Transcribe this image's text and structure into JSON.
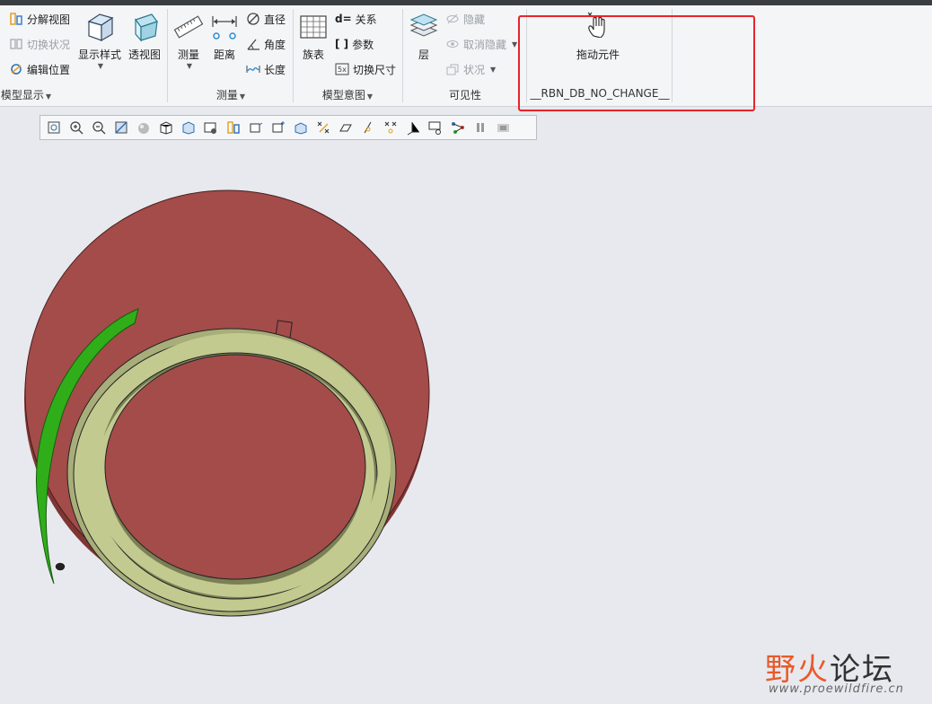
{
  "ribbon": {
    "model_display": {
      "exploded_view": "分解视图",
      "toggle_status": "切换状况",
      "edit_position": "编辑位置",
      "display_style": "显示样式",
      "perspective": "透视图",
      "group_label": "模型显示"
    },
    "measure": {
      "measure": "测量",
      "distance": "距离",
      "diameter": "直径",
      "angle": "角度",
      "length": "长度",
      "group_label": "测量"
    },
    "model_intent": {
      "family_table": "族表",
      "relations_prefix": "d=",
      "relations": "关系",
      "parameters_prefix": "[ ]",
      "parameters": "参数",
      "switch_dims": "切换尺寸",
      "group_label": "模型意图"
    },
    "visibility": {
      "layers": "层",
      "hide": "隐藏",
      "unhide": "取消隐藏",
      "status": "状况",
      "group_label": "可见性"
    },
    "custom": {
      "drag_components": "拖动元件",
      "group_label": "__RBN_DB_NO_CHANGE__"
    }
  },
  "view_toolbar": {
    "buttons": [
      "refit-icon",
      "zoom-in-icon",
      "zoom-out-icon",
      "repaint-icon",
      "display-style-icon",
      "saved-orientations-icon",
      "named-views-icon",
      "view-manager-icon",
      "datum-display-icon",
      "plane-display-icon",
      "axis-display-icon",
      "csys-display-icon",
      "point-display-icon",
      "annotation-display-icon",
      "spin-center-icon",
      "connect-icon",
      "pause-icon",
      "tools-icon"
    ]
  },
  "watermark": {
    "title_a": "野",
    "title_b": "火",
    "title_c": "论坛",
    "url": "www.proewildfire.cn"
  },
  "colors": {
    "accent_red": "#e8232a",
    "model_red": "#a34c4a",
    "model_ring": "#c2ca8f",
    "model_green": "#2fae1a"
  }
}
